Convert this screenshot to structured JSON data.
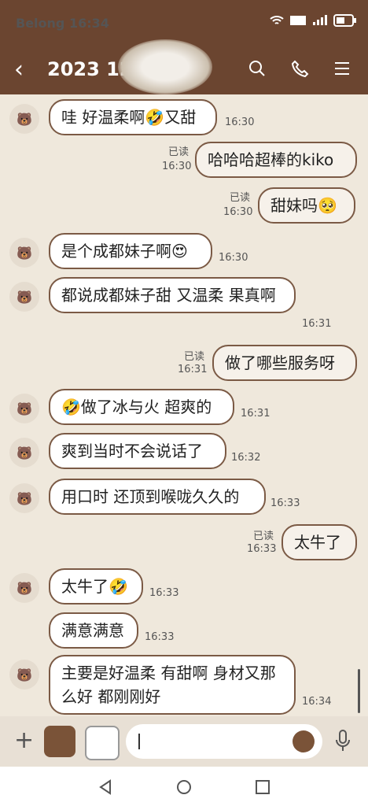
{
  "status": {
    "carrier": "Belong",
    "time": "16:34"
  },
  "header": {
    "title": "2023 12"
  },
  "messages": [
    {
      "side": "left",
      "text": "哇 好温柔啊🤣又甜",
      "time": "16:30"
    },
    {
      "side": "right",
      "text": "哈哈哈超棒的kiko",
      "time": "16:30",
      "read": "已读"
    },
    {
      "side": "right",
      "text": "甜妹吗🥺",
      "time": "16:30",
      "read": "已读"
    },
    {
      "side": "left",
      "text": "是个成都妹子啊😍",
      "time": "16:30"
    },
    {
      "side": "left",
      "text": "都说成都妹子甜 又温柔 果真啊",
      "time": "16:31"
    },
    {
      "side": "right",
      "text": "做了哪些服务呀",
      "time": "16:31",
      "read": "已读"
    },
    {
      "side": "left",
      "text": "🤣做了冰与火 超爽的",
      "time": "16:31"
    },
    {
      "side": "left",
      "text": "爽到当时不会说话了",
      "time": "16:32"
    },
    {
      "side": "left",
      "text": "用口时 还顶到喉咙久久的",
      "time": "16:33"
    },
    {
      "side": "right",
      "text": "太牛了",
      "time": "16:33",
      "read": "已读"
    },
    {
      "side": "left",
      "text": "太牛了🤣",
      "time": "16:33"
    },
    {
      "side": "left",
      "text": "满意满意",
      "time": "16:33"
    },
    {
      "side": "left",
      "text": "主要是好温柔 有甜啊 身材又那么好 都刚刚好",
      "time": "16:34"
    }
  ]
}
